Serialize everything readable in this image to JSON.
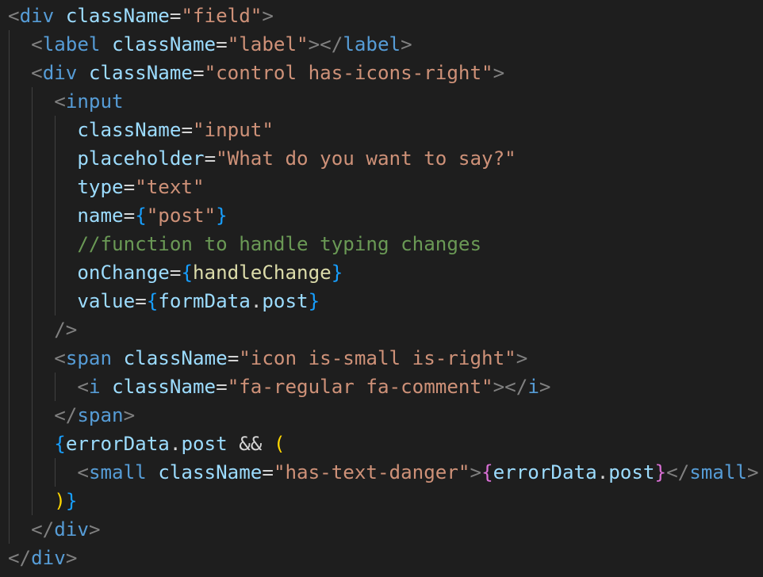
{
  "editor": {
    "language": "jsx",
    "theme": "dark",
    "background": "#1e1e1e",
    "colors": {
      "punct": "#808080",
      "tag": "#569cd6",
      "attr": "#9cdcfe",
      "str": "#ce9178",
      "op": "#d4d4d4",
      "brace": "#179fff",
      "paren": "#ffd700",
      "brace2": "#da70d6",
      "var": "#9cdcfe",
      "fn": "#dcdcaa",
      "comment": "#6a9955",
      "plain": "#d4d4d4"
    },
    "lines": [
      {
        "indent": 0,
        "tokens": [
          {
            "t": "<",
            "c": "punct"
          },
          {
            "t": "div",
            "c": "tag"
          },
          {
            "t": " ",
            "c": "plain"
          },
          {
            "t": "className",
            "c": "attr"
          },
          {
            "t": "=",
            "c": "op"
          },
          {
            "t": "\"field\"",
            "c": "str"
          },
          {
            "t": ">",
            "c": "punct"
          }
        ]
      },
      {
        "indent": 1,
        "tokens": [
          {
            "t": "<",
            "c": "punct"
          },
          {
            "t": "label",
            "c": "tag"
          },
          {
            "t": " ",
            "c": "plain"
          },
          {
            "t": "className",
            "c": "attr"
          },
          {
            "t": "=",
            "c": "op"
          },
          {
            "t": "\"label\"",
            "c": "str"
          },
          {
            "t": "></",
            "c": "punct"
          },
          {
            "t": "label",
            "c": "tag"
          },
          {
            "t": ">",
            "c": "punct"
          }
        ]
      },
      {
        "indent": 1,
        "tokens": [
          {
            "t": "<",
            "c": "punct"
          },
          {
            "t": "div",
            "c": "tag"
          },
          {
            "t": " ",
            "c": "plain"
          },
          {
            "t": "className",
            "c": "attr"
          },
          {
            "t": "=",
            "c": "op"
          },
          {
            "t": "\"control has-icons-right\"",
            "c": "str"
          },
          {
            "t": ">",
            "c": "punct"
          }
        ]
      },
      {
        "indent": 2,
        "tokens": [
          {
            "t": "<",
            "c": "punct"
          },
          {
            "t": "input",
            "c": "tag"
          }
        ]
      },
      {
        "indent": 3,
        "tokens": [
          {
            "t": "className",
            "c": "attr"
          },
          {
            "t": "=",
            "c": "op"
          },
          {
            "t": "\"input\"",
            "c": "str"
          }
        ]
      },
      {
        "indent": 3,
        "tokens": [
          {
            "t": "placeholder",
            "c": "attr"
          },
          {
            "t": "=",
            "c": "op"
          },
          {
            "t": "\"What do you want to say?\"",
            "c": "str"
          }
        ]
      },
      {
        "indent": 3,
        "tokens": [
          {
            "t": "type",
            "c": "attr"
          },
          {
            "t": "=",
            "c": "op"
          },
          {
            "t": "\"text\"",
            "c": "str"
          }
        ]
      },
      {
        "indent": 3,
        "tokens": [
          {
            "t": "name",
            "c": "attr"
          },
          {
            "t": "=",
            "c": "op"
          },
          {
            "t": "{",
            "c": "brace"
          },
          {
            "t": "\"post\"",
            "c": "str"
          },
          {
            "t": "}",
            "c": "brace"
          }
        ]
      },
      {
        "indent": 3,
        "tokens": [
          {
            "t": "//function to handle typing changes",
            "c": "comment"
          }
        ]
      },
      {
        "indent": 3,
        "tokens": [
          {
            "t": "onChange",
            "c": "attr"
          },
          {
            "t": "=",
            "c": "op"
          },
          {
            "t": "{",
            "c": "brace"
          },
          {
            "t": "handleChange",
            "c": "fn"
          },
          {
            "t": "}",
            "c": "brace"
          }
        ]
      },
      {
        "indent": 3,
        "tokens": [
          {
            "t": "value",
            "c": "attr"
          },
          {
            "t": "=",
            "c": "op"
          },
          {
            "t": "{",
            "c": "brace"
          },
          {
            "t": "formData",
            "c": "var"
          },
          {
            "t": ".",
            "c": "plain"
          },
          {
            "t": "post",
            "c": "var"
          },
          {
            "t": "}",
            "c": "brace"
          }
        ]
      },
      {
        "indent": 2,
        "tokens": [
          {
            "t": "/>",
            "c": "punct"
          }
        ]
      },
      {
        "indent": 2,
        "tokens": [
          {
            "t": "<",
            "c": "punct"
          },
          {
            "t": "span",
            "c": "tag"
          },
          {
            "t": " ",
            "c": "plain"
          },
          {
            "t": "className",
            "c": "attr"
          },
          {
            "t": "=",
            "c": "op"
          },
          {
            "t": "\"icon is-small is-right\"",
            "c": "str"
          },
          {
            "t": ">",
            "c": "punct"
          }
        ]
      },
      {
        "indent": 3,
        "tokens": [
          {
            "t": "<",
            "c": "punct"
          },
          {
            "t": "i",
            "c": "tag"
          },
          {
            "t": " ",
            "c": "plain"
          },
          {
            "t": "className",
            "c": "attr"
          },
          {
            "t": "=",
            "c": "op"
          },
          {
            "t": "\"fa-regular fa-comment\"",
            "c": "str"
          },
          {
            "t": "></",
            "c": "punct"
          },
          {
            "t": "i",
            "c": "tag"
          },
          {
            "t": ">",
            "c": "punct"
          }
        ]
      },
      {
        "indent": 2,
        "tokens": [
          {
            "t": "</",
            "c": "punct"
          },
          {
            "t": "span",
            "c": "tag"
          },
          {
            "t": ">",
            "c": "punct"
          }
        ]
      },
      {
        "indent": 2,
        "tokens": [
          {
            "t": "{",
            "c": "brace"
          },
          {
            "t": "errorData",
            "c": "var"
          },
          {
            "t": ".",
            "c": "plain"
          },
          {
            "t": "post",
            "c": "var"
          },
          {
            "t": " && ",
            "c": "op"
          },
          {
            "t": "(",
            "c": "paren"
          }
        ]
      },
      {
        "indent": 3,
        "tokens": [
          {
            "t": "<",
            "c": "punct"
          },
          {
            "t": "small",
            "c": "tag"
          },
          {
            "t": " ",
            "c": "plain"
          },
          {
            "t": "className",
            "c": "attr"
          },
          {
            "t": "=",
            "c": "op"
          },
          {
            "t": "\"has-text-danger\"",
            "c": "str"
          },
          {
            "t": ">",
            "c": "punct"
          },
          {
            "t": "{",
            "c": "brace2"
          },
          {
            "t": "errorData",
            "c": "var"
          },
          {
            "t": ".",
            "c": "plain"
          },
          {
            "t": "post",
            "c": "var"
          },
          {
            "t": "}",
            "c": "brace2"
          },
          {
            "t": "</",
            "c": "punct"
          },
          {
            "t": "small",
            "c": "tag"
          },
          {
            "t": ">",
            "c": "punct"
          }
        ]
      },
      {
        "indent": 2,
        "tokens": [
          {
            "t": ")",
            "c": "paren"
          },
          {
            "t": "}",
            "c": "brace"
          }
        ]
      },
      {
        "indent": 1,
        "tokens": [
          {
            "t": "</",
            "c": "punct"
          },
          {
            "t": "div",
            "c": "tag"
          },
          {
            "t": ">",
            "c": "punct"
          }
        ]
      },
      {
        "indent": 0,
        "tokens": [
          {
            "t": "</",
            "c": "punct"
          },
          {
            "t": "div",
            "c": "tag"
          },
          {
            "t": ">",
            "c": "punct"
          }
        ]
      }
    ]
  }
}
